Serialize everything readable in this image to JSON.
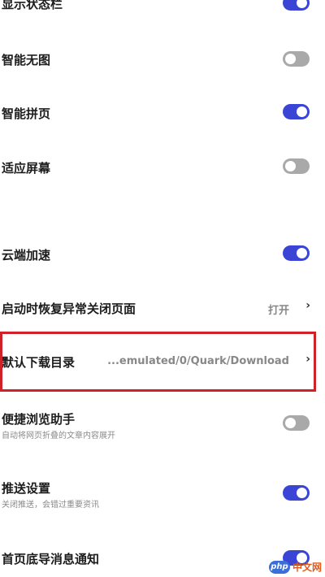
{
  "settings": {
    "show_status_bar": {
      "label": "显示状态栏",
      "on": true
    },
    "smart_no_image": {
      "label": "智能无图",
      "on": false
    },
    "smart_page_join": {
      "label": "智能拼页",
      "on": true
    },
    "fit_screen": {
      "label": "适应屏幕",
      "on": false
    },
    "cloud_accel": {
      "label": "云端加速",
      "on": true
    },
    "restore_pages": {
      "label": "启动时恢复异常关闭页面",
      "value": "打开"
    },
    "download_dir": {
      "label": "默认下载目录",
      "value": "...emulated/0/Quark/Download"
    },
    "quick_browse": {
      "label": "便捷浏览助手",
      "sub": "自动将网页折叠的文章内容展开",
      "on": false
    },
    "push_settings": {
      "label": "推送设置",
      "sub": "关闭推送，会错过重要资讯",
      "on": true
    },
    "home_bottom_notice": {
      "label": "首页底导消息通知",
      "on": true
    }
  },
  "icons": {
    "chevron": "›",
    "chevron_name": "chevron-right-icon"
  },
  "colors": {
    "toggle_on": "#3a45d6",
    "toggle_off": "#a9a9a9",
    "highlight": "#d0212a"
  },
  "watermark": {
    "logo": "php",
    "text": "中文网"
  }
}
